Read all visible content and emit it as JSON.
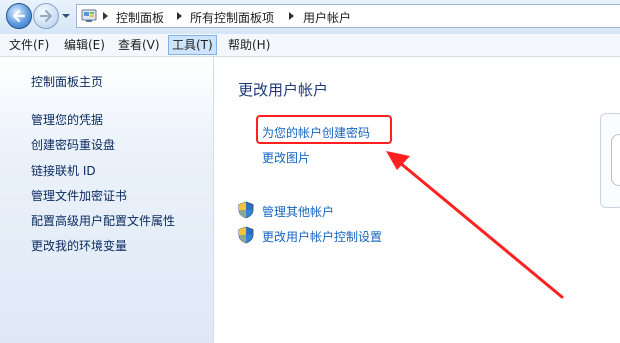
{
  "address_bar": {
    "breadcrumbs": [
      "控制面板",
      "所有控制面板项",
      "用户帐户"
    ]
  },
  "menu": {
    "items": [
      "文件(F)",
      "编辑(E)",
      "查看(V)",
      "工具(T)",
      "帮助(H)"
    ],
    "active": "工具(T)"
  },
  "left_pane": {
    "home_link": "控制面板主页",
    "links": [
      "管理您的凭据",
      "创建密码重设盘",
      "链接联机 ID",
      "管理文件加密证书",
      "配置高级用户配置文件属性",
      "更改我的环境变量"
    ]
  },
  "main": {
    "title": "更改用户帐户",
    "tasks": [
      "为您的帐户创建密码",
      "更改图片"
    ],
    "admin_tasks": [
      "管理其他帐户",
      "更改用户帐户控制设置"
    ]
  },
  "colors": {
    "link": "#1565c0",
    "title": "#1e3a7b",
    "highlight": "#ff2020"
  },
  "icons": [
    "back-icon",
    "forward-icon",
    "control-panel-icon",
    "uac-shield-icon"
  ]
}
